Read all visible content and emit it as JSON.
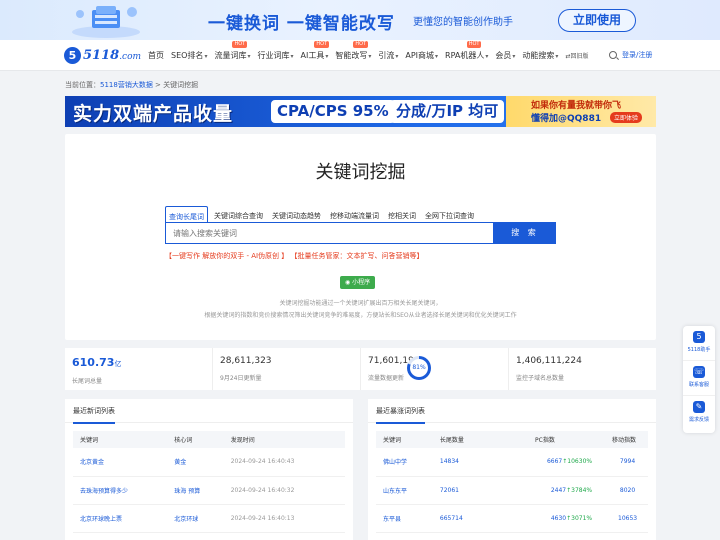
{
  "banner": {
    "main": "一键换词 一键智能改写",
    "sub": "更懂您的智能创作助手",
    "button": "立即使用"
  },
  "nav": {
    "logo_mark": "5",
    "logo_text": "5118",
    "logo_suffix": ".com",
    "items": [
      {
        "label": "首页",
        "caret": false,
        "hot": false
      },
      {
        "label": "SEO排名",
        "caret": true,
        "hot": false
      },
      {
        "label": "流量词库",
        "caret": true,
        "hot": true
      },
      {
        "label": "行业词库",
        "caret": true,
        "hot": false
      },
      {
        "label": "AI工具",
        "caret": true,
        "hot": true
      },
      {
        "label": "智能改写",
        "caret": true,
        "hot": true
      },
      {
        "label": "引流",
        "caret": true,
        "hot": false
      },
      {
        "label": "API商城",
        "caret": true,
        "hot": false
      },
      {
        "label": "RPA机器人",
        "caret": true,
        "hot": true
      },
      {
        "label": "会员",
        "caret": true,
        "hot": false
      },
      {
        "label": "动能搜索",
        "caret": true,
        "hot": false
      }
    ],
    "hot_label": "HOT",
    "old_version": "⇄回旧版",
    "login": "登录/注册"
  },
  "breadcrumb": {
    "prefix": "当前位置：",
    "link": "5118营销大数据",
    "sep": " > ",
    "current": "关键词挖掘"
  },
  "ad": {
    "t1": "实力双端产品收量",
    "b1": "CPA/CPS 95%",
    "b2": "分成/万IP 均可",
    "r1": "如果你有量我就带你飞",
    "r2": "懂得加@QQ881",
    "r3": "立即体验"
  },
  "main": {
    "title": "关键词挖掘",
    "tabs": [
      "查询长尾词",
      "关键词综合查询",
      "关键词动态趋势",
      "挖移动端流量词",
      "挖相关词",
      "全网下拉词查询"
    ],
    "search_placeholder": "请输入搜索关键词",
    "search_button": "搜 索",
    "promo_a": "【一键写作 解放你的双手 - AI伪原创 】",
    "promo_b": "【批量任务管家：文本扩写、问答营销等】",
    "mini_program": "小程序",
    "desc1": "关键词挖掘功能通过一个关键词扩展出百万相关长尾关键词，",
    "desc2": "根据关键词的指数和竞价搜索情况筛出关键词竞争的难易度，方便站长和SEO从业者选择长尾关键词和优化关键词工作"
  },
  "stats": [
    {
      "value": "610.73",
      "unit": "亿",
      "label": "长尾词总量"
    },
    {
      "value": "28,611,323",
      "label": "9月24日更新量"
    },
    {
      "value": "71,601,194",
      "label": "流量数据更新",
      "percent": 81,
      "percent_label": "81%"
    },
    {
      "value": "1,406,111,224",
      "label": "监控子域名总数量"
    }
  ],
  "left_panel": {
    "title": "最近新词列表",
    "headers": [
      "关键词",
      "核心词",
      "发现时间"
    ],
    "rows": [
      [
        "北京黄金",
        "黄金",
        "2024-09-24 16:40:43"
      ],
      [
        "去珠海预算得多少",
        "珠海 预算",
        "2024-09-24 16:40:32"
      ],
      [
        "北京环球晚上票",
        "北京环球",
        "2024-09-24 16:40:13"
      ]
    ]
  },
  "right_panel": {
    "title": "最近暴涨词列表",
    "headers": [
      "关键词",
      "长尾数量",
      "PC指数",
      "移动指数"
    ],
    "rows": [
      [
        "佛山中学",
        "14834",
        "6667",
        "↑10630%",
        "7994"
      ],
      [
        "山东东平",
        "72061",
        "2447",
        "↑3784%",
        "8020"
      ],
      [
        "东平县",
        "665714",
        "4630",
        "↑3071%",
        "10653"
      ]
    ]
  },
  "side": [
    {
      "icon": "5",
      "label": "5118助手"
    },
    {
      "icon": "☏",
      "label": "联系客服"
    },
    {
      "icon": "✎",
      "label": "需求反馈"
    }
  ]
}
